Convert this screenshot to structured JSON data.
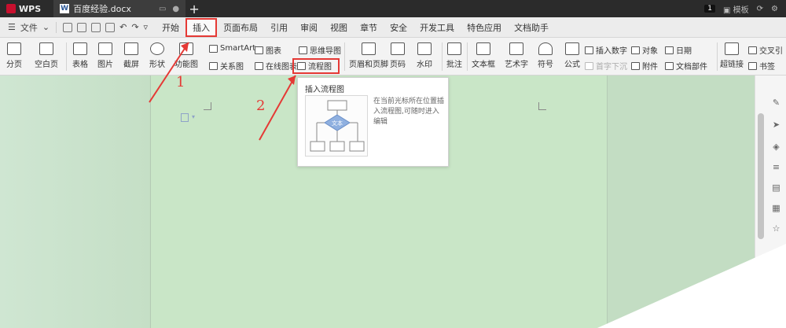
{
  "titlebar": {
    "app_name": "WPS",
    "doc_tab": "百度经验.docx",
    "new_tab": "+",
    "badge": "1",
    "template_label": "模板"
  },
  "menubar": {
    "file": "文件",
    "tabs": [
      "开始",
      "插入",
      "页面布局",
      "引用",
      "审阅",
      "视图",
      "章节",
      "安全",
      "开发工具",
      "特色应用",
      "文档助手"
    ],
    "active_tab": "插入"
  },
  "ribbon": {
    "page_break": "分页",
    "blank_page": "空白页",
    "table": "表格",
    "picture": "图片",
    "screenshot": "截屏",
    "shape": "形状",
    "function_chart": "功能图",
    "smartart": "SmartArt",
    "chart": "图表",
    "relation_chart": "关系图",
    "online_chart": "在线图表",
    "mind_map": "思维导图",
    "flowchart": "流程图",
    "header_footer": "页眉和页脚",
    "page_number": "页码",
    "watermark": "水印",
    "comment": "批注",
    "textbox": "文本框",
    "wordart": "艺术字",
    "symbol": "符号",
    "formula": "公式",
    "insert_number": "插入数字",
    "first_drop": "首字下沉",
    "object": "对象",
    "attachment": "附件",
    "date": "日期",
    "doc_parts": "文档部件",
    "hyperlink": "超链接",
    "cross_ref": "交叉引",
    "bookmark": "书签"
  },
  "tooltip": {
    "title": "插入流程图",
    "preview_label": "文本",
    "description": "在当前光标所在位置插入流程图,可随时进入编辑"
  },
  "annotations": {
    "step1": "1",
    "step2": "2",
    "color": "#e53935"
  }
}
